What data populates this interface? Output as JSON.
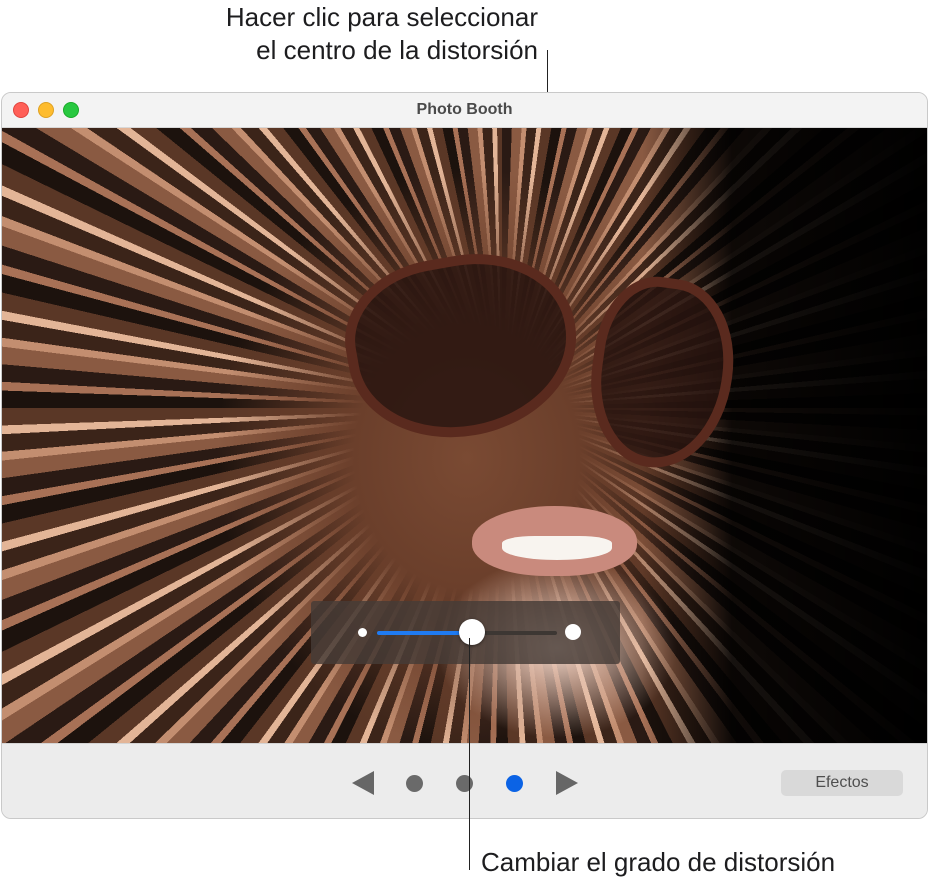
{
  "callouts": {
    "top_line1": "Hacer clic para seleccionar",
    "top_line2": "el centro de la distorsión",
    "bottom": "Cambiar el grado de distorsión"
  },
  "window": {
    "title": "Photo Booth"
  },
  "distortion_slider": {
    "value_fraction": 0.53
  },
  "carousel": {
    "page_count": 3,
    "selected_page": 3
  },
  "toolbar": {
    "effects_label": "Efectos"
  },
  "colors": {
    "accent": "#1f7bf2",
    "selected_dot": "#0b63e5",
    "close": "#ff5f57",
    "minimize": "#febc2e",
    "zoom": "#28c840"
  },
  "icons": {
    "prev": "triangle-left-icon",
    "next": "triangle-right-icon"
  }
}
